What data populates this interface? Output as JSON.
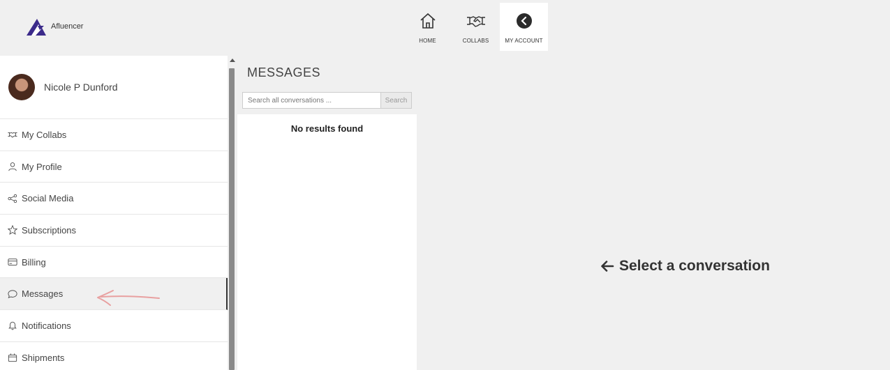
{
  "brand": {
    "name": "Afluencer",
    "logo_color": "#3b2a8a"
  },
  "topnav": [
    {
      "label": "HOME",
      "icon": "home-icon"
    },
    {
      "label": "COLLABS",
      "icon": "handshake-icon"
    },
    {
      "label": "MY ACCOUNT",
      "icon": "chevron-left-circle-icon",
      "active": true
    }
  ],
  "profile": {
    "name": "Nicole P Dunford"
  },
  "sidebar": {
    "items": [
      {
        "label": "My Collabs",
        "icon": "handshake-icon"
      },
      {
        "label": "My Profile",
        "icon": "user-icon"
      },
      {
        "label": "Social Media",
        "icon": "share-icon"
      },
      {
        "label": "Subscriptions",
        "icon": "star-icon"
      },
      {
        "label": "Billing",
        "icon": "credit-card-icon"
      },
      {
        "label": "Messages",
        "icon": "chat-bubble-icon",
        "active": true
      },
      {
        "label": "Notifications",
        "icon": "bell-icon"
      },
      {
        "label": "Shipments",
        "icon": "package-icon"
      }
    ]
  },
  "messages": {
    "title": "MESSAGES",
    "search_placeholder": "Search all conversations ...",
    "search_button": "Search",
    "empty_text": "No results found"
  },
  "main": {
    "empty_state": "Select a conversation",
    "empty_state_icon": "arrow-left-icon"
  },
  "annotation": {
    "color": "#e8a0a0",
    "icon": "hand-drawn-arrow-icon"
  }
}
